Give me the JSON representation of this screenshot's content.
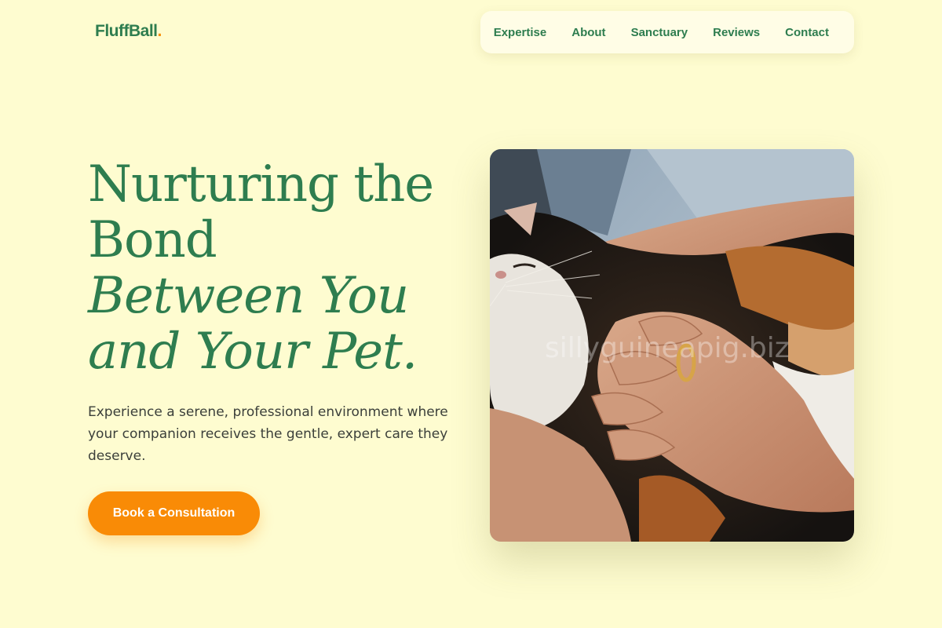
{
  "brand": {
    "name": "FluffBall",
    "dot": ".",
    "dot_color": "#f58b00",
    "color": "#2e7d4f"
  },
  "nav": {
    "items": [
      {
        "label": "Expertise"
      },
      {
        "label": "About"
      },
      {
        "label": "Sanctuary"
      },
      {
        "label": "Reviews"
      },
      {
        "label": "Contact"
      }
    ]
  },
  "hero": {
    "headline_line1": "Nurturing the",
    "headline_line2": "Bond",
    "headline_line3": "Between You",
    "headline_line4": "and Your Pet.",
    "subtitle": "Experience a serene, professional environment where your companion receives the gentle, expert care they deserve.",
    "cta_label": "Book a Consultation",
    "image_watermark": "sillyguineapig.biz"
  },
  "colors": {
    "background": "#fefcd0",
    "accent_green": "#2e7d4f",
    "cta_orange": "#f98b06"
  }
}
